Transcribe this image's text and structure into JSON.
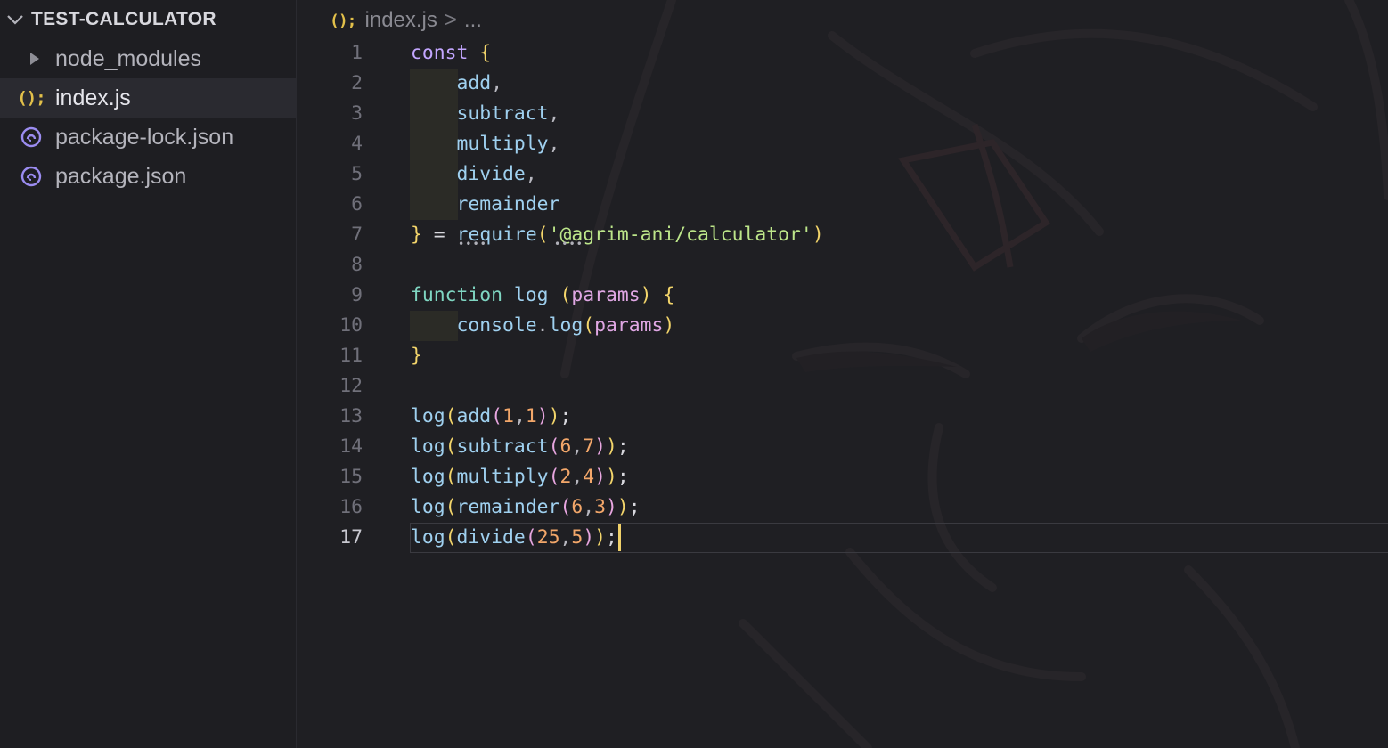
{
  "explorer": {
    "title": "TEST-CALCULATOR",
    "items": [
      {
        "label": "node_modules",
        "type": "folder",
        "icon": "caret-right-icon"
      },
      {
        "label": "index.js",
        "type": "js",
        "icon": "js-icon"
      },
      {
        "label": "package-lock.json",
        "type": "json",
        "icon": "package-icon"
      },
      {
        "label": "package.json",
        "type": "json",
        "icon": "package-icon"
      }
    ]
  },
  "breadcrumb": {
    "icon_text": "();",
    "file": "index.js",
    "separator": ">",
    "more": "..."
  },
  "editor": {
    "language": "javascript",
    "line_numbers": [
      "1",
      "2",
      "3",
      "4",
      "5",
      "6",
      "7",
      "8",
      "9",
      "10",
      "11",
      "12",
      "13",
      "14",
      "15",
      "16",
      "17"
    ],
    "lines": [
      "const {",
      "    add,",
      "    subtract,",
      "    multiply,",
      "    divide,",
      "    remainder",
      "} = require('@agrim-ani/calculator')",
      "",
      "function log (params) {",
      "    console.log(params)",
      "}",
      "",
      "log(add(1,1));",
      "log(subtract(6,7));",
      "log(multiply(2,4));",
      "log(remainder(6,3));",
      "log(divide(25,5));"
    ],
    "current_line": 17
  },
  "colors": {
    "background": "#1f1f23",
    "sidebar": "#1e1e22",
    "keyword": "#c3a6ff",
    "string": "#bde68a",
    "number": "#f3a76a",
    "bracket": "#f3d56b",
    "identifier": "#9fd0ef",
    "cursor": "#f0d16a"
  }
}
